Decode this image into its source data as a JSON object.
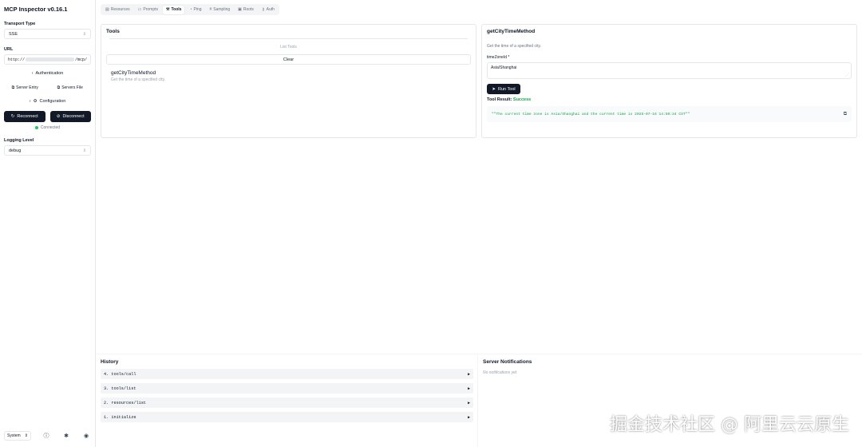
{
  "app": {
    "title": "MCP Inspector v0.16.1"
  },
  "sidebar": {
    "transport_label": "Transport Type",
    "transport_value": "SSE",
    "url_label": "URL",
    "url_prefix": "http://",
    "url_suffix": "/mcp/",
    "auth_label": "Authentication",
    "server_entry_label": "Server Entry",
    "servers_file_label": "Servers File",
    "config_label": "Configuration",
    "reconnect_label": "Reconnect",
    "disconnect_label": "Disconnect",
    "status": "Connected",
    "status_color": "#22c55e",
    "logging_label": "Logging Level",
    "logging_value": "debug",
    "theme_value": "System"
  },
  "tabs": [
    {
      "label": "Resources",
      "icon": "resources-icon"
    },
    {
      "label": "Prompts",
      "icon": "prompts-icon"
    },
    {
      "label": "Tools",
      "icon": "wrench-icon",
      "active": true
    },
    {
      "label": "Ping",
      "icon": "bell-icon"
    },
    {
      "label": "Sampling",
      "icon": "hash-icon"
    },
    {
      "label": "Roots",
      "icon": "folder-icon"
    },
    {
      "label": "Auth",
      "icon": "key-icon"
    }
  ],
  "tools": {
    "title": "Tools",
    "list_label": "List Tools",
    "clear_label": "Clear",
    "items": [
      {
        "name": "getCityTimeMethod",
        "desc": "Get the time of a specified city."
      }
    ]
  },
  "detail": {
    "title": "getCityTimeMethod",
    "desc": "Get the time of a specified city.",
    "param_label": "timeZoneId *",
    "param_value": "Asia/Shanghai",
    "run_label": "Run Tool",
    "result_label": "Tool Result:",
    "result_status": "Success",
    "result_text": "\"\"The current time zone is Asia/Shanghai and the current time is 2025-07-16 14:50:34 CST\"\""
  },
  "history": {
    "title": "History",
    "items": [
      "4. tools/call",
      "3. tools/list",
      "2. resources/list",
      "1. initialize"
    ]
  },
  "notifications": {
    "title": "Server Notifications",
    "empty": "No notifications yet"
  },
  "watermark": "掘金技术社区 @ 阿里云云原生"
}
